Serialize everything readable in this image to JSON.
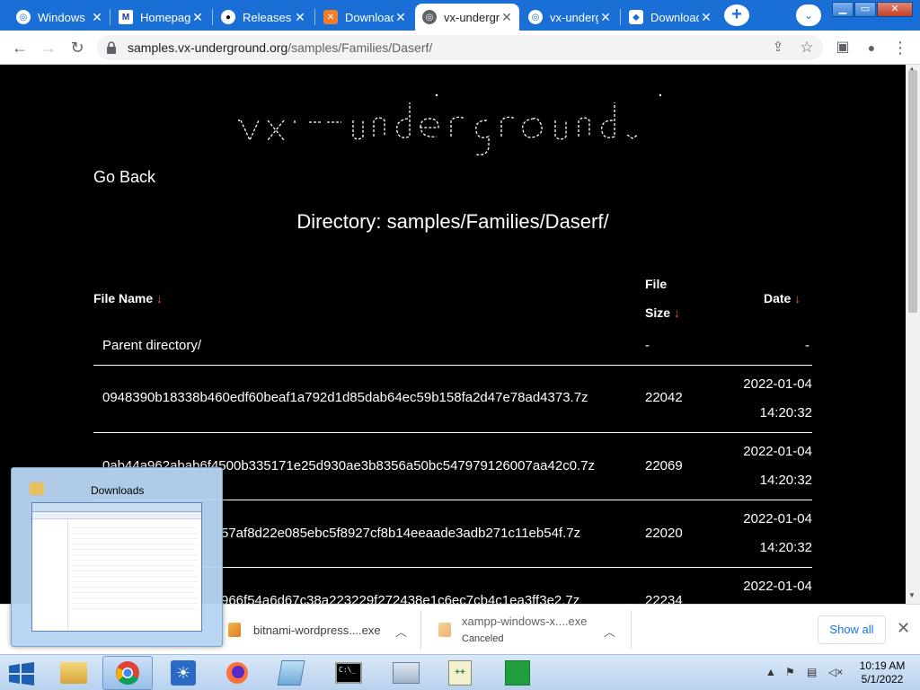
{
  "tabs": [
    {
      "title": "Windows",
      "icon": "chrome-globe-icon"
    },
    {
      "title": "Homepage",
      "icon": "mspaint-icon"
    },
    {
      "title": "Releases",
      "icon": "github-icon"
    },
    {
      "title": "Downloads",
      "icon": "xampp-icon"
    },
    {
      "title": "vx-underground",
      "icon": "chrome-globe-icon",
      "active": true
    },
    {
      "title": "vx-underground",
      "icon": "chrome-globe-icon"
    },
    {
      "title": "Downloads",
      "icon": "bitnami-icon"
    }
  ],
  "window_controls": {
    "minimize": "▁",
    "restore": "▭",
    "close": "✕"
  },
  "toolbar": {
    "new_tab": "+",
    "tab_search": "⌄",
    "back": "←",
    "forward": "→",
    "reload": "↻",
    "url_host": "samples.vx-underground.org",
    "url_path": "/samples/Families/Daserf/",
    "share": "⇪",
    "bookmark": "☆",
    "sidepanel": "▣",
    "profile": "●",
    "menu": "⋮"
  },
  "page": {
    "go_back": "Go Back",
    "directory_title": "Directory: samples/Families/Daserf/",
    "headers": {
      "file_name": "File Name",
      "file_size_line1": "File",
      "file_size_line2": "Size",
      "date": "Date",
      "sort_arrow": "↓"
    },
    "parent": {
      "name": "Parent directory/",
      "size": "-",
      "date": "-"
    },
    "rows": [
      {
        "name": "0948390b18338b460edf60beaf1a792d1d85dab64ec59b158fa2d47e78ad4373.7z",
        "size": "22042",
        "date": "2022-01-04",
        "time": "14:20:32"
      },
      {
        "name": "0ab44a962abab6f4500b335171e25d930ae3b8356a50bc547979126007aa42c0.7z",
        "size": "22069",
        "date": "2022-01-04",
        "time": "14:20:32"
      },
      {
        "name": "57af8d22e085ebc5f8927cf8b14eeaade3adb271c11eb54f.7z",
        "size": "22020",
        "date": "2022-01-04",
        "time": "14:20:32"
      },
      {
        "name": "966f54a6d67c38a223229f272438e1c6ec7cb4c1ea3ff3e2.7z",
        "size": "22234",
        "date": "2022-01-04",
        "time": ""
      }
    ]
  },
  "downloads": {
    "items": [
      {
        "name": "bitnami-wordpress....exe",
        "status": ""
      },
      {
        "name": "xampp-windows-x....exe",
        "status": "Canceled"
      }
    ],
    "show_all": "Show all",
    "close": "✕"
  },
  "thumbnail": {
    "title": "Downloads"
  },
  "taskbar": {
    "time": "10:19 AM",
    "date": "5/1/2022"
  }
}
